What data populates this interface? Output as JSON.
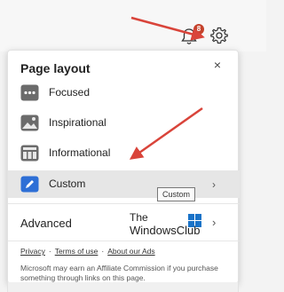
{
  "header": {
    "notification_count": "8",
    "bell_icon": "bell-icon",
    "settings_icon": "gear-icon"
  },
  "panel": {
    "title": "Page layout",
    "close_icon": "close-icon",
    "options": [
      {
        "label": "Focused",
        "icon": "focused-layout-icon",
        "selected": false
      },
      {
        "label": "Inspirational",
        "icon": "inspirational-layout-icon",
        "selected": false
      },
      {
        "label": "Informational",
        "icon": "informational-layout-icon",
        "selected": false
      },
      {
        "label": "Custom",
        "icon": "custom-layout-icon",
        "selected": true
      }
    ],
    "advanced_label": "Advanced",
    "tooltip": "Custom",
    "links": [
      "Privacy",
      "Terms of use",
      "About our Ads"
    ],
    "disclaimer": "Microsoft may earn an Affiliate Commission if you purchase something through links on this page."
  },
  "watermark": {
    "line1": "The",
    "line2": "WindowsClub"
  },
  "colors": {
    "accent": "#2e6fd6",
    "badge": "#c4422b",
    "arrow": "#d9443a",
    "selected_bg": "#e6e6e6"
  }
}
